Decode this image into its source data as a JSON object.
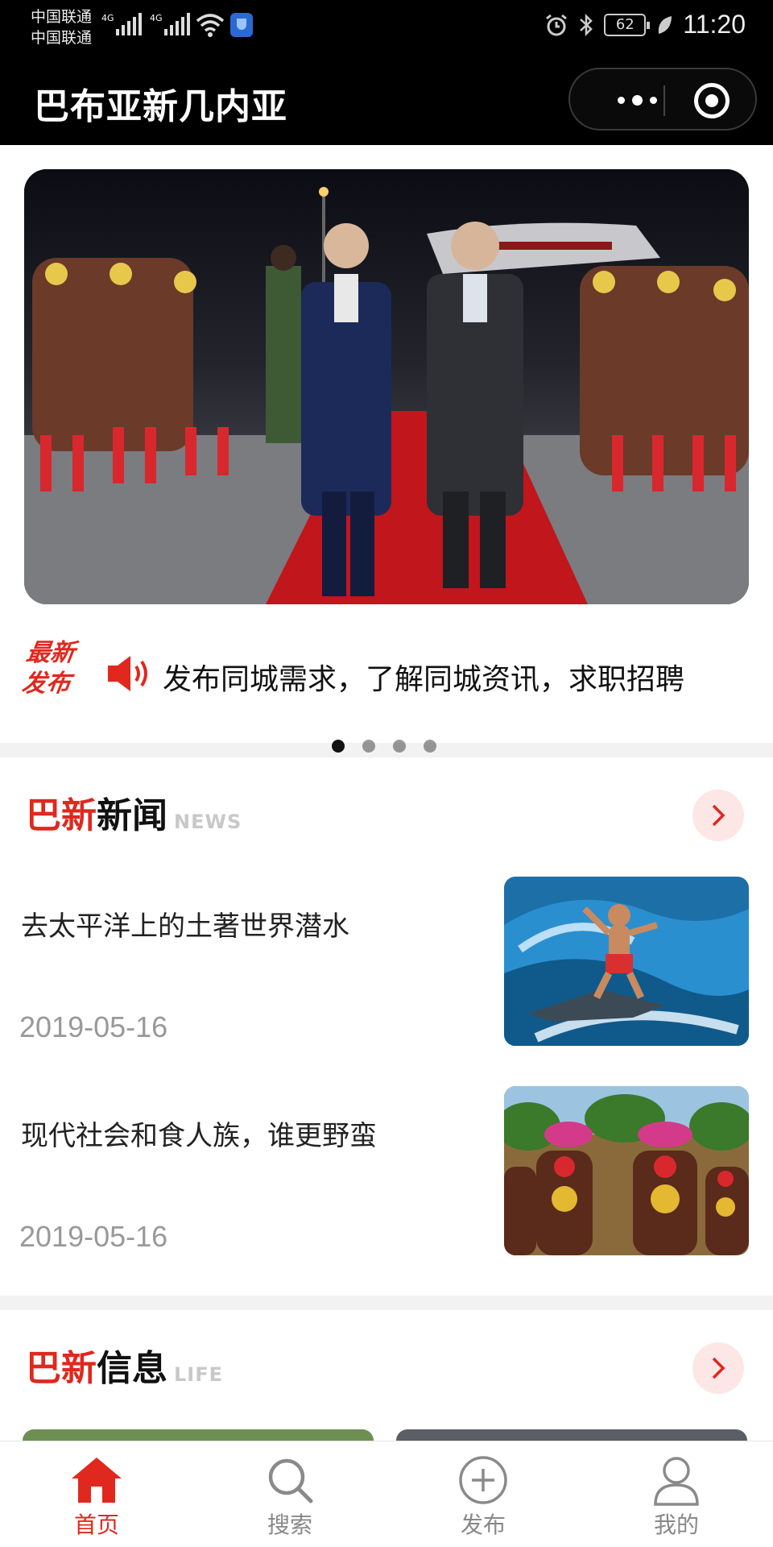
{
  "status_bar": {
    "carrier_1": "中国联通",
    "carrier_2": "中国联通",
    "network_1": "4G",
    "network_2": "4G",
    "battery": "62",
    "time": "11:20"
  },
  "app_title": "巴布亚新几内亚",
  "banner": {
    "slide_count": 4,
    "active_slide": 1
  },
  "ticker": {
    "badge_line1": "最新",
    "badge_line2": "发布",
    "text": "发布同城需求，了解同城资讯，求职招聘"
  },
  "news_section": {
    "title_red": "巴新",
    "title_black": "新闻",
    "title_en": "NEWS",
    "items": [
      {
        "title": "去太平洋上的土著世界潜水",
        "date": "2019-05-16",
        "thumb": "surfer-wave-photo"
      },
      {
        "title": "现代社会和食人族，谁更野蛮",
        "date": "2019-05-16",
        "thumb": "tribal-dancers-photo"
      }
    ]
  },
  "info_section": {
    "title_red": "巴新",
    "title_black": "信息",
    "title_en": "LIFE"
  },
  "tabbar": {
    "items": [
      {
        "label": "首页",
        "icon": "home-icon",
        "active": true
      },
      {
        "label": "搜索",
        "icon": "search-icon",
        "active": false
      },
      {
        "label": "发布",
        "icon": "plus-circle-icon",
        "active": false
      },
      {
        "label": "我的",
        "icon": "user-icon",
        "active": false
      }
    ]
  },
  "colors": {
    "accent": "#e0281e",
    "title_bar": "#000000",
    "inactive_tab": "#888888"
  }
}
